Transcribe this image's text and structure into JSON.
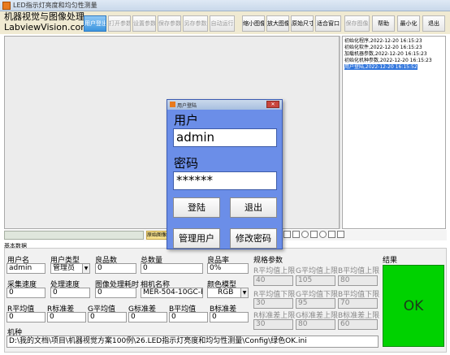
{
  "window": {
    "title": "LED指示灯亮度和均匀性测量"
  },
  "header": {
    "logo_line1": "机器视觉与图像处理",
    "logo_line2": "LabviewVision.com"
  },
  "toolbar": [
    {
      "label": "用户登出",
      "state": "active"
    },
    {
      "label": "打开参数",
      "state": "disabled"
    },
    {
      "label": "设置参数",
      "state": "disabled"
    },
    {
      "label": "保存参数",
      "state": "disabled"
    },
    {
      "label": "另存参数",
      "state": "disabled"
    },
    {
      "label": "自动运行",
      "state": "disabled"
    },
    {
      "label": "缩小图像",
      "state": "normal"
    },
    {
      "label": "放大图像",
      "state": "normal"
    },
    {
      "label": "原始尺寸",
      "state": "normal"
    },
    {
      "label": "适合窗口",
      "state": "normal"
    },
    {
      "label": "保存图像",
      "state": "disabled"
    },
    {
      "label": "帮助",
      "state": "normal"
    },
    {
      "label": "最小化",
      "state": "normal"
    },
    {
      "label": "退出",
      "state": "normal"
    }
  ],
  "log": [
    "初始化程序,2022-12-20 16:15:23",
    "初始化软件,2022-12-20 16:15:23",
    "加载机器参数,2022-12-20 16:15:23",
    "初始化机种参数,2022-12-20 16:15:23",
    "用户登陆,2022-12-20 16:15:52"
  ],
  "image_view": {
    "original_button": "原始图像"
  },
  "bottom": {
    "section_label": "基本数据",
    "user_name": {
      "label": "用户名",
      "value": "admin"
    },
    "user_type": {
      "label": "用户类型",
      "value": "管理员"
    },
    "good_count": {
      "label": "良品数",
      "value": "0"
    },
    "total_count": {
      "label": "总数量",
      "value": "0"
    },
    "yield": {
      "label": "良品率",
      "value": "0%"
    },
    "capture_speed": {
      "label": "采集速度",
      "value": "0"
    },
    "process_speed": {
      "label": "处理速度",
      "value": "0"
    },
    "proc_time": {
      "label": "图像处理耗时",
      "value": "0"
    },
    "camera_name": {
      "label": "相机名称",
      "value": "MER-504-10GC-P"
    },
    "color_model": {
      "label": "颜色模型",
      "value": "RGB"
    },
    "r_avg": {
      "label": "R平均值",
      "value": "0"
    },
    "r_std": {
      "label": "R标准差",
      "value": "0"
    },
    "g_avg": {
      "label": "G平均值",
      "value": "0"
    },
    "g_std": {
      "label": "G标准差",
      "value": "0"
    },
    "b_avg": {
      "label": "B平均值",
      "value": "0"
    },
    "b_std": {
      "label": "B标准差",
      "value": "0"
    },
    "model": {
      "label": "机种",
      "value": "D:\\我的文档\\项目\\机器视觉方案100例\\26.LED指示灯亮度和均匀性测量\\Config\\绿色OK.ini"
    },
    "spec": {
      "label": "规格参数",
      "row1_labels": [
        "R平均值上限",
        "G平均值上限",
        "B平均值上限"
      ],
      "row1_values": [
        "40",
        "105",
        "80"
      ],
      "row2_labels": [
        "R平均值下限",
        "G平均值下限",
        "B平均值下限"
      ],
      "row2_values": [
        "30",
        "95",
        "70"
      ],
      "row3_labels": [
        "R标准差上限",
        "G标准差上限",
        "B标准差上限"
      ],
      "row3_values": [
        "30",
        "80",
        "60"
      ]
    },
    "result": {
      "label": "结果",
      "value": "OK"
    }
  },
  "login_dialog": {
    "title": "用户登陆",
    "user_label": "用户",
    "user_value": "admin",
    "password_label": "密码",
    "password_value": "******",
    "login_button": "登陆",
    "exit_button": "退出",
    "manage_button": "管理用户",
    "change_pw_button": "修改密码"
  }
}
